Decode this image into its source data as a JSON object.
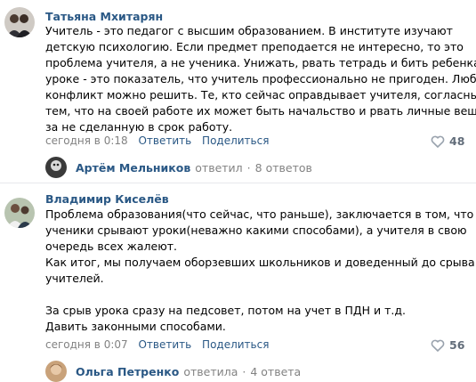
{
  "comments": [
    {
      "author": "Татьяна Мхитарян",
      "text_lines": [
        "Учитель - это педагог с высшим образованием. В институте изучают",
        "детскую психологию. Если предмет преподается не интересно, то это",
        "проблема учителя, а не ученика. Унижать, рвать тетрадь и бить ребенка на",
        "уроке - это показатель, что учитель профессионально не пригоден. Любой",
        "конфликт можно решить. Те, кто сейчас оправдывает учителя, согласны с",
        "тем, что на своей работе их может быть начальство и рвать личные вещи",
        "за не сделанную в срок работу."
      ],
      "time": "сегодня в 0:18",
      "reply_label": "Ответить",
      "share_label": "Поделиться",
      "likes": "48",
      "thread": {
        "name": "Артём Мельников",
        "action": "ответил",
        "count": "8 ответов"
      }
    },
    {
      "author": "Владимир Киселёв",
      "text_lines": [
        "Проблема образования(что сейчас, что раньше), заключается в том, что",
        "ученики срывают уроки(неважно какими способами), а учителя в свою",
        "очередь всех жалеют.",
        "Как итог, мы получаем оборзевших школьников и доведенный до срыва",
        "учителей.",
        "",
        "За срыв урока сразу на педсовет, потом на учет в ПДН и т.д.",
        "Давить законными способами."
      ],
      "time": "сегодня в 0:07",
      "reply_label": "Ответить",
      "share_label": "Поделиться",
      "likes": "56",
      "thread": {
        "name": "Ольга Петренко",
        "action": "ответила",
        "count": "4 ответа"
      }
    }
  ],
  "colors": {
    "link": "#2a5885",
    "meta": "#828282",
    "divider": "#e7e8ec"
  }
}
